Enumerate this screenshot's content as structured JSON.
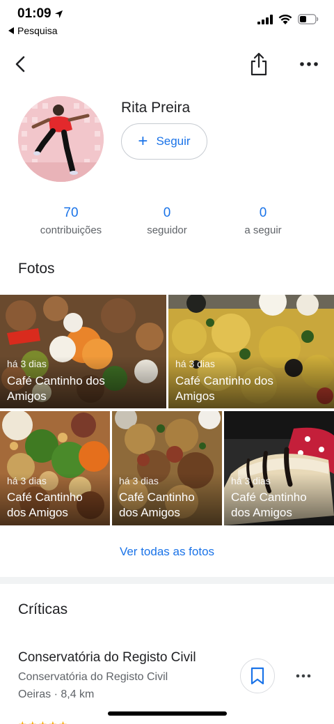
{
  "status_bar": {
    "time": "01:09",
    "back_label": "Pesquisa"
  },
  "profile": {
    "name": "Rita Preira",
    "follow_label": "Seguir",
    "stats": [
      {
        "value": "70",
        "label": "contribuições"
      },
      {
        "value": "0",
        "label": "seguidor"
      },
      {
        "value": "0",
        "label": "a seguir"
      }
    ]
  },
  "photos_section": {
    "title": "Fotos",
    "items": [
      {
        "when": "há 3 dias",
        "place": "Café Cantinho dos Amigos"
      },
      {
        "when": "há 3 dias",
        "place": "Café Cantinho dos Amigos"
      },
      {
        "when": "há 3 dias",
        "place": "Café Cantinho dos Amigos"
      },
      {
        "when": "há 3 dias",
        "place": "Café Cantinho dos Amigos"
      },
      {
        "when": "há 3 dias",
        "place": "Café Cantinho dos Amigos"
      }
    ],
    "see_all_label": "Ver todas as fotos"
  },
  "reviews_section": {
    "title": "Críticas",
    "items": [
      {
        "title": "Conservatória do Registo Civil",
        "category": "Conservatória do Registo Civil",
        "location": "Oeiras · 8,4 km"
      }
    ]
  },
  "colors": {
    "accent": "#1a73e8",
    "secondary_text": "#5f6368",
    "star": "#f9ab00"
  }
}
